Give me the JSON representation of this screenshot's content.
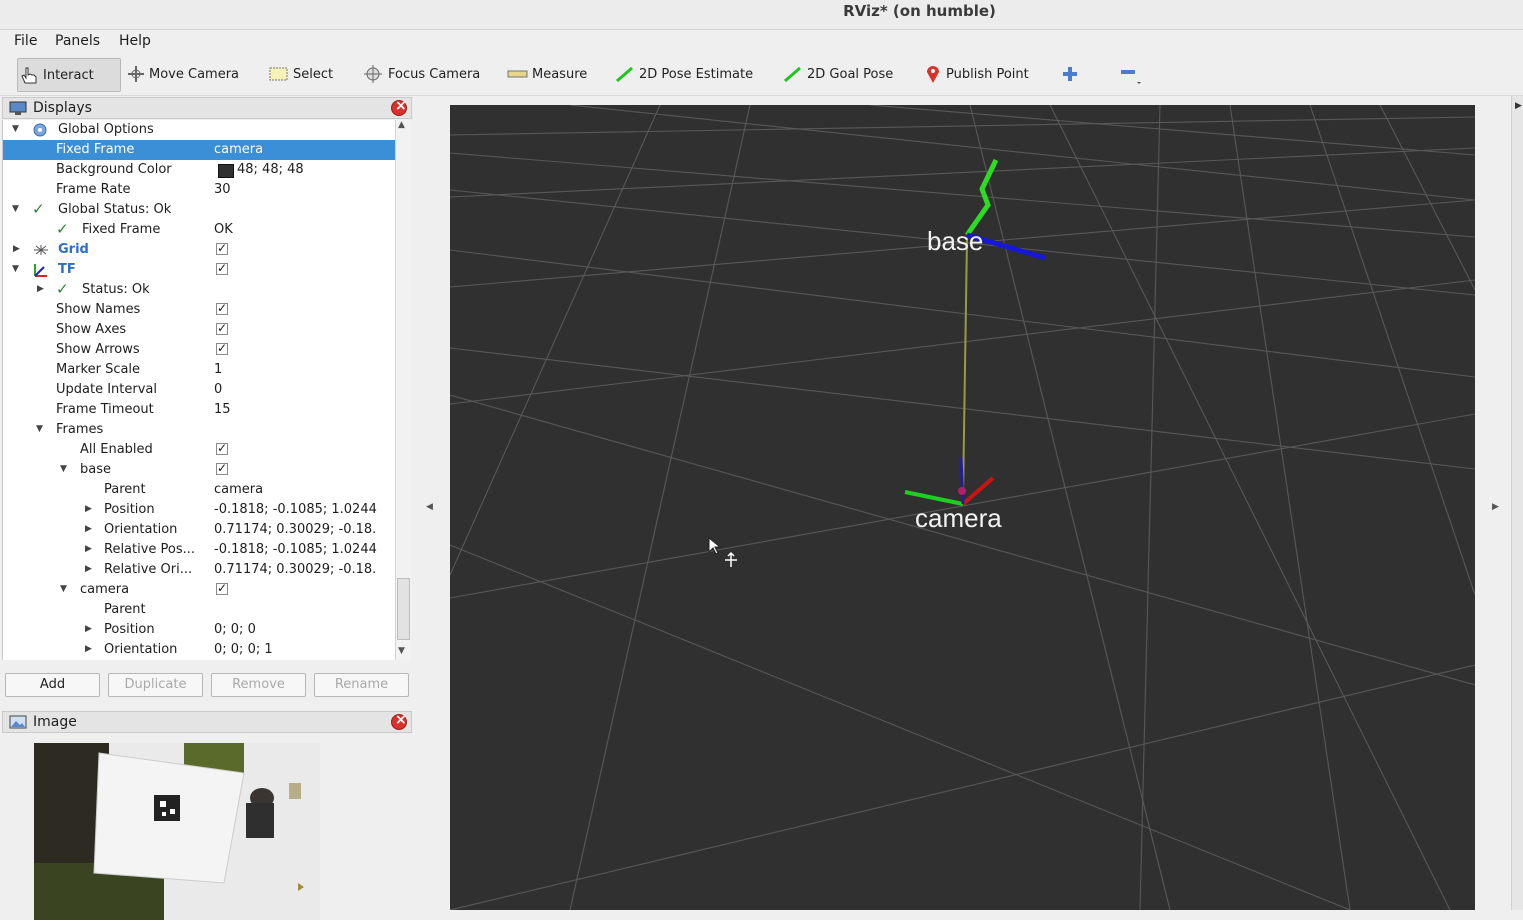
{
  "window": {
    "title": "RViz* (on humble)"
  },
  "menu": {
    "file": "File",
    "panels": "Panels",
    "help": "Help"
  },
  "toolbar": {
    "interact": "Interact",
    "move_camera": "Move Camera",
    "select": "Select",
    "focus_camera": "Focus Camera",
    "measure": "Measure",
    "pose_estimate": "2D Pose Estimate",
    "goal_pose": "2D Goal Pose",
    "publish_point": "Publish Point"
  },
  "displays": {
    "title": "Displays",
    "rows": {
      "global_options": "Global Options",
      "fixed_frame": "Fixed Frame",
      "fixed_frame_val": "camera",
      "bg_color": "Background Color",
      "bg_color_val": "48; 48; 48",
      "frame_rate": "Frame Rate",
      "frame_rate_val": "30",
      "global_status": "Global Status: Ok",
      "gs_fixed_frame": "Fixed Frame",
      "gs_fixed_frame_val": "OK",
      "grid": "Grid",
      "tf": "TF",
      "tf_status": "Status: Ok",
      "show_names": "Show Names",
      "show_axes": "Show Axes",
      "show_arrows": "Show Arrows",
      "marker_scale": "Marker Scale",
      "marker_scale_val": "1",
      "update_interval": "Update Interval",
      "update_interval_val": "0",
      "frame_timeout": "Frame Timeout",
      "frame_timeout_val": "15",
      "frames": "Frames",
      "all_enabled": "All Enabled",
      "base": "base",
      "base_parent": "Parent",
      "base_parent_val": "camera",
      "base_position": "Position",
      "base_position_val": "-0.1818; -0.1085; 1.0244",
      "base_orientation": "Orientation",
      "base_orientation_val": "0.71174; 0.30029; -0.18.",
      "base_rel_pos": "Relative Pos...",
      "base_rel_pos_val": "-0.1818; -0.1085; 1.0244",
      "base_rel_ori": "Relative Ori...",
      "base_rel_ori_val": "0.71174; 0.30029; -0.18.",
      "camera": "camera",
      "camera_parent": "Parent",
      "camera_position": "Position",
      "camera_position_val": "0; 0; 0",
      "camera_orientation": "Orientation",
      "camera_orientation_val": "0; 0; 0; 1"
    },
    "buttons": {
      "add": "Add",
      "duplicate": "Duplicate",
      "remove": "Remove",
      "rename": "Rename"
    }
  },
  "image_panel": {
    "title": "Image"
  },
  "viewport": {
    "base_label": "base",
    "camera_label": "camera",
    "background": "#303030"
  },
  "colors": {
    "selection": "#3a8fd6",
    "close": "#d9312b",
    "axis_x": "#e01010",
    "axis_y": "#22dd22",
    "axis_z": "#1a1adc"
  }
}
